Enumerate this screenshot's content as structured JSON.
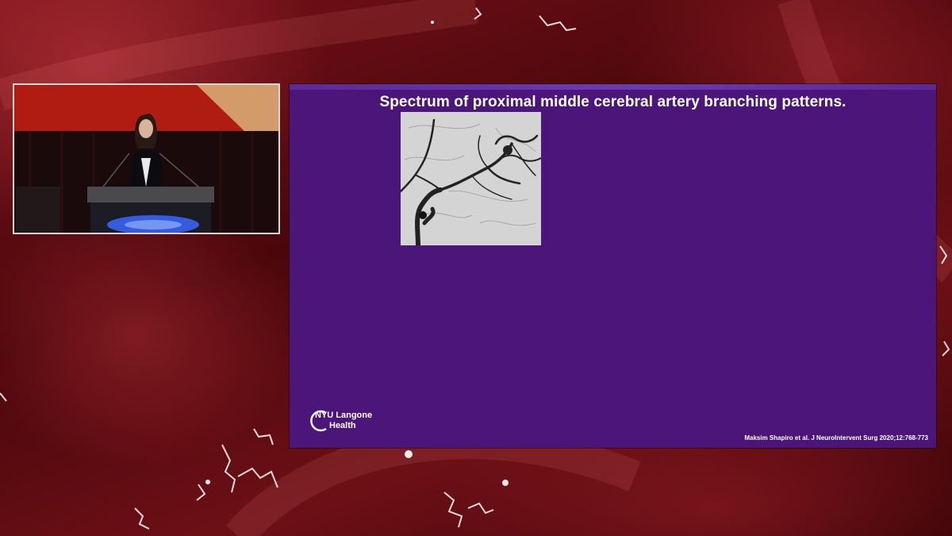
{
  "slide": {
    "title": "Spectrum of proximal middle cerebral artery branching patterns.",
    "logo": {
      "line1": "NYU Langone",
      "line2": "Health"
    },
    "citation": "Maksim Shapiro et al. J NeuroIntervent Surg 2020;12:768-773"
  },
  "colors": {
    "slide_background": "#4c157a",
    "background_red": "#6d1016",
    "panel_border": "#d8d8d8"
  }
}
